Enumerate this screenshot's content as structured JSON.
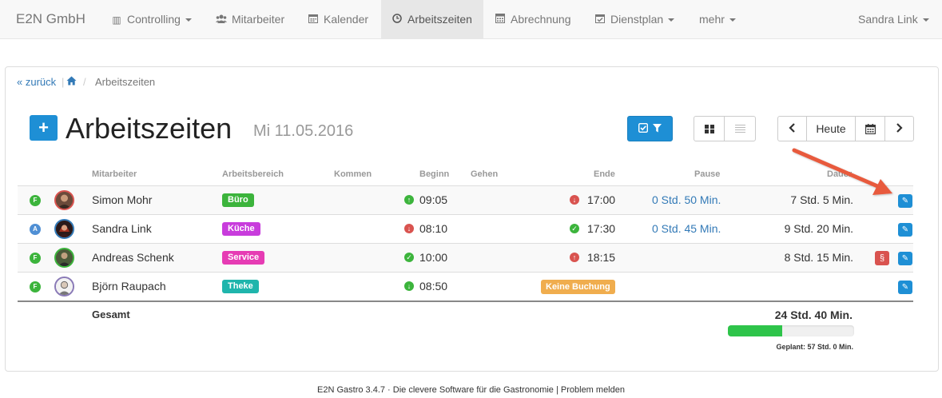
{
  "navbar": {
    "brand": "E2N GmbH",
    "items": [
      {
        "label": "Controlling",
        "icon": "bar-chart-icon",
        "glyph": "▥",
        "dropdown": true
      },
      {
        "label": "Mitarbeiter",
        "icon": "users-icon",
        "glyph": "👥",
        "dropdown": false
      },
      {
        "label": "Kalender",
        "icon": "calendar-icon",
        "glyph": "▦",
        "dropdown": false
      },
      {
        "label": "Arbeitszeiten",
        "icon": "clock-icon",
        "glyph": "◷",
        "dropdown": false,
        "active": true
      },
      {
        "label": "Abrechnung",
        "icon": "calculator-icon",
        "glyph": "▦",
        "dropdown": false
      },
      {
        "label": "Dienstplan",
        "icon": "calendar-check-icon",
        "glyph": "☑",
        "dropdown": true
      },
      {
        "label": "mehr",
        "icon": "",
        "glyph": "",
        "dropdown": true
      }
    ],
    "user": "Sandra Link"
  },
  "breadcrumb": {
    "back": "« zurück",
    "home_icon": "home-icon",
    "current": "Arbeitszeiten"
  },
  "header": {
    "add_label": "+",
    "title": "Arbeitszeiten",
    "date": "Mi 11.05.2016",
    "today_label": "Heute"
  },
  "table": {
    "columns": {
      "employee": "Mitarbeiter",
      "area": "Arbeitsbereich",
      "come": "Kommen",
      "begin": "Beginn",
      "go": "Gehen",
      "end": "Ende",
      "pause": "Pause",
      "duration": "Dauer"
    },
    "rows": [
      {
        "status": "F",
        "status_color": "#3cb43c",
        "name": "Simon Mohr",
        "area": "Büro",
        "area_color": "#3cb43c",
        "begin": "09:05",
        "begin_icon": "up",
        "end": "17:00",
        "end_icon": "down",
        "pause": "0 Std. 50 Min.",
        "duration": "7 Std. 5 Min.",
        "law": ""
      },
      {
        "status": "A",
        "status_color": "#4f8fd4",
        "name": "Sandra Link",
        "area": "Küche",
        "area_color": "#c83cdc",
        "begin": "08:10",
        "begin_icon": "down",
        "end": "17:30",
        "end_icon": "check",
        "pause": "0 Std. 45 Min.",
        "duration": "9 Std. 20 Min.",
        "law": ""
      },
      {
        "status": "F",
        "status_color": "#3cb43c",
        "name": "Andreas Schenk",
        "area": "Service",
        "area_color": "#e63cb4",
        "begin": "10:00",
        "begin_icon": "check",
        "end": "18:15",
        "end_icon": "up",
        "pause": "",
        "duration": "8 Std. 15 Min.",
        "law": "§"
      },
      {
        "status": "F",
        "status_color": "#3cb43c",
        "name": "Björn Raupach",
        "area": "Theke",
        "area_color": "#1fb5ac",
        "begin": "08:50",
        "begin_icon": "down-green",
        "end": "",
        "end_icon": "",
        "no_booking": "Keine Buchung",
        "pause": "",
        "duration": "",
        "law": ""
      }
    ]
  },
  "totals": {
    "label": "Gesamt",
    "value": "24 Std. 40 Min.",
    "planned": "Geplant: 57 Std. 0 Min.",
    "progress_fraction": 0.43
  },
  "footer": "E2N Gastro 3.4.7 · Die clevere Software für die Gastronomie | Problem melden",
  "colors": {
    "primary": "#1e8fd5",
    "success": "#3cb43c",
    "danger": "#d9534f",
    "warning": "#f0ad4e",
    "annotation_arrow": "#e85a3c"
  }
}
